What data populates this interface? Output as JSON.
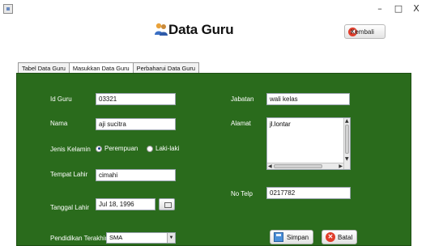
{
  "window": {
    "minimize_glyph": "–",
    "maximize_glyph": "□",
    "close_glyph": "X"
  },
  "header": {
    "title": "Data Guru",
    "back_label": "Kembali",
    "back_icon": "arrow-left-icon"
  },
  "tabs": [
    {
      "label": "Tabel Data Guru"
    },
    {
      "label": "Masukkan Data Guru"
    },
    {
      "label": "Perbaharui Data Guru"
    }
  ],
  "form": {
    "id_guru": {
      "label": "Id Guru",
      "value": "03321"
    },
    "nama": {
      "label": "Nama",
      "value": "aji sucitra"
    },
    "jenis_kelamin": {
      "label": "Jenis Kelamin",
      "options": [
        "Perempuan",
        "Laki-laki"
      ],
      "selected": "Perempuan"
    },
    "tempat_lahir": {
      "label": "Tempat Lahir",
      "value": "cimahi"
    },
    "tanggal_lahir": {
      "label": "Tanggal Lahir",
      "value": "Jul 18, 1996"
    },
    "pendidikan": {
      "label": "Pendidikan Terakhir",
      "value": "SMA"
    },
    "jabatan": {
      "label": "Jabatan",
      "value": "wali kelas"
    },
    "alamat": {
      "label": "Alamat",
      "value": "jl.lontar"
    },
    "no_telp": {
      "label": "No Telp",
      "value": "0217782"
    }
  },
  "actions": {
    "save_label": "Simpan",
    "cancel_label": "Batal"
  },
  "colors": {
    "panel_bg": "#2a6b1c",
    "cancel_accent": "#e03c2a",
    "save_accent": "#4a8fd8"
  }
}
